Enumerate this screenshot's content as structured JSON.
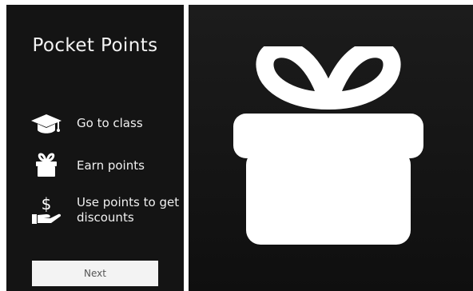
{
  "app": {
    "title": "Pocket Points"
  },
  "features": [
    {
      "icon": "graduation-cap-icon",
      "label": "Go to class"
    },
    {
      "icon": "gift-icon",
      "label": "Earn points"
    },
    {
      "icon": "hand-dollar-icon",
      "label": "Use points to get discounts"
    }
  ],
  "actions": {
    "next_label": "Next"
  },
  "hero": {
    "icon": "gift-icon"
  },
  "colors": {
    "panel_background": "#141414",
    "text": "#f2f2f2",
    "button_background": "#f3f3f3",
    "button_text": "#555555",
    "icon": "#ffffff"
  }
}
